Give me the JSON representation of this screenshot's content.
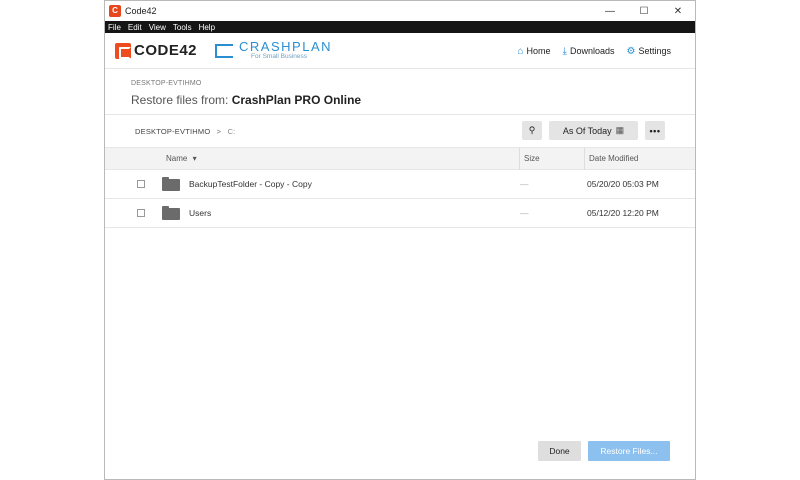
{
  "window": {
    "title": "Code42",
    "app_icon_letter": "C",
    "controls": {
      "minimize": "—",
      "maximize": "☐",
      "close": "✕"
    }
  },
  "menu": [
    "File",
    "Edit",
    "View",
    "Tools",
    "Help"
  ],
  "header": {
    "code42_logo": "CODE42",
    "crashplan_logo": "CRASHPLAN",
    "crashplan_sub": "For Small Business",
    "nav": [
      {
        "label": "Home",
        "icon": "home-icon",
        "glyph": "⌂"
      },
      {
        "label": "Downloads",
        "icon": "download-icon",
        "glyph": "⤓"
      },
      {
        "label": "Settings",
        "icon": "gear-icon",
        "glyph": "⚙"
      }
    ]
  },
  "restore": {
    "device": "DESKTOP-EVTIHMO",
    "title_prefix": "Restore files from:",
    "title_source": "CrashPlan PRO Online"
  },
  "toolbar": {
    "breadcrumb_device": "DESKTOP-EVTIHMO",
    "breadcrumb_sep": ">",
    "breadcrumb_drive": "C:",
    "search_glyph": "⚲",
    "as_of_label": "As Of Today",
    "calendar_glyph": "▦",
    "more_glyph": "•••"
  },
  "table": {
    "columns": {
      "name": "Name",
      "sort_glyph": "▾",
      "size": "Size",
      "date": "Date Modified"
    },
    "rows": [
      {
        "name": "BackupTestFolder - Copy - Copy",
        "size": "—",
        "date": "05/20/20 05:03 PM"
      },
      {
        "name": "Users",
        "size": "—",
        "date": "05/12/20 12:20 PM"
      }
    ]
  },
  "footer": {
    "done_label": "Done",
    "restore_label": "Restore Files..."
  },
  "colors": {
    "code42_orange": "#ee4b1e",
    "crashplan_blue": "#2a8fd0",
    "restore_button": "#8cc0ee"
  }
}
